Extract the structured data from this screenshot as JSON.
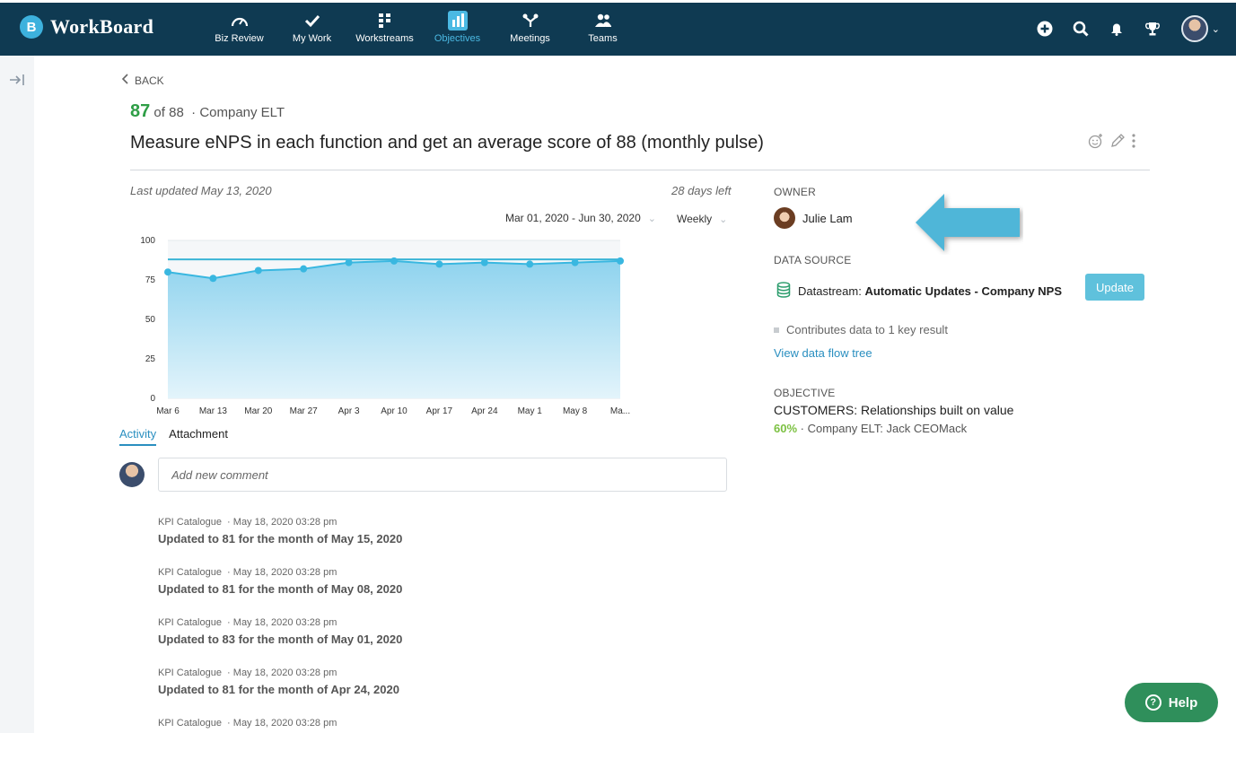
{
  "app": {
    "name": "WorkBoard",
    "logo_letter": "B"
  },
  "nav": {
    "items": [
      {
        "label": "Biz Review",
        "icon": "gauge-icon"
      },
      {
        "label": "My Work",
        "icon": "check-icon"
      },
      {
        "label": "Workstreams",
        "icon": "workstreams-icon"
      },
      {
        "label": "Objectives",
        "icon": "bar-chart-icon",
        "active": true
      },
      {
        "label": "Meetings",
        "icon": "meetings-icon"
      },
      {
        "label": "Teams",
        "icon": "teams-icon"
      }
    ],
    "actions": [
      "add-icon",
      "search-icon",
      "bell-icon",
      "trophy-icon",
      "user-avatar"
    ]
  },
  "back_label": "BACK",
  "score": {
    "current": "87",
    "of_text": "of 88",
    "team": "Company ELT"
  },
  "title": "Measure eNPS in each function and get an average score of 88 (monthly pulse)",
  "meta": {
    "last_updated": "Last updated May 13, 2020",
    "days_left": "28 days left",
    "date_range": "Mar 01, 2020 - Jun 30, 2020",
    "frequency": "Weekly"
  },
  "chart_data": {
    "type": "area",
    "x": [
      "Mar 6",
      "Mar 13",
      "Mar 20",
      "Mar 27",
      "Apr 3",
      "Apr 10",
      "Apr 17",
      "Apr 24",
      "May 1",
      "May 8",
      "Ma..."
    ],
    "y_ticks": [
      0,
      25,
      50,
      75,
      100
    ],
    "ylim": [
      0,
      100
    ],
    "series": [
      {
        "values": [
          80,
          76,
          81,
          82,
          86,
          87,
          85,
          86,
          85,
          86,
          87
        ]
      }
    ],
    "target": 88,
    "colors": {
      "line": "#39b7e0",
      "fill_top": "#8fd3ee",
      "fill_bottom": "#e3f4fb",
      "target": "#3ab4d6"
    }
  },
  "tabs": [
    "Activity",
    "Attachment"
  ],
  "comment_placeholder": "Add new comment",
  "activity": [
    {
      "source": "KPI Catalogue",
      "time": "May 18, 2020 03:28 pm",
      "text": "Updated to 81 for the month of May 15, 2020"
    },
    {
      "source": "KPI Catalogue",
      "time": "May 18, 2020 03:28 pm",
      "text": "Updated to 81 for the month of May 08, 2020"
    },
    {
      "source": "KPI Catalogue",
      "time": "May 18, 2020 03:28 pm",
      "text": "Updated to 83 for the month of May 01, 2020"
    },
    {
      "source": "KPI Catalogue",
      "time": "May 18, 2020 03:28 pm",
      "text": "Updated to 81 for the month of Apr 24, 2020"
    },
    {
      "source": "KPI Catalogue",
      "time": "May 18, 2020 03:28 pm",
      "text": ""
    }
  ],
  "owner": {
    "label": "OWNER",
    "name": "Julie Lam"
  },
  "data_source": {
    "label": "DATA SOURCE",
    "prefix": "Datastream:",
    "name": "Automatic Updates - Company NPS",
    "button": "Update",
    "contributes": "Contributes data to 1 key result",
    "link": "View data flow tree"
  },
  "objective": {
    "label": "OBJECTIVE",
    "title": "CUSTOMERS: Relationships built on value",
    "percent": "60%",
    "owner": "Company ELT: Jack CEOMack"
  },
  "help_label": "Help",
  "colors": {
    "topbar": "#0f3a52",
    "accent": "#4bb9e3",
    "score": "#2e9e46",
    "help": "#2f8f5b",
    "callout_arrow": "#4fb6d8"
  }
}
